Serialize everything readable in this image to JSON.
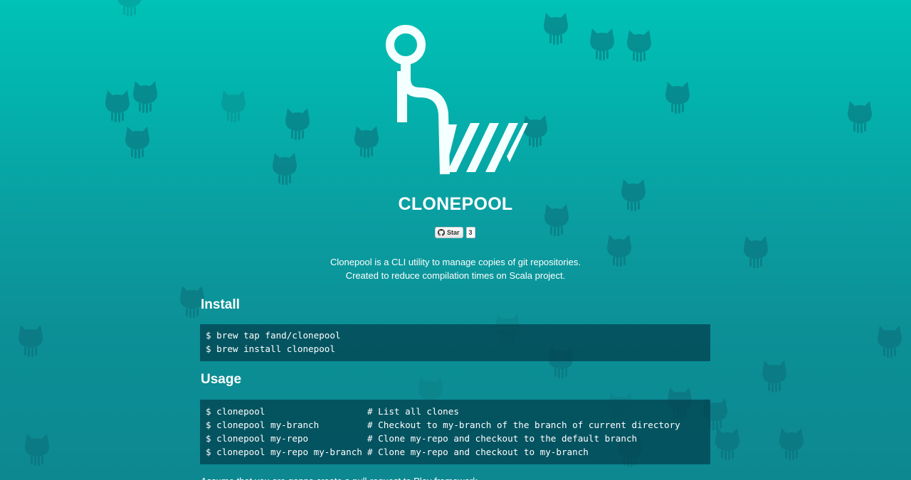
{
  "header": {
    "title": "CLONEPOOL"
  },
  "github_star": {
    "label": "Star",
    "count": "3",
    "icon": "github-octocat-icon"
  },
  "tagline": {
    "line1": "Clonepool is a CLI utility to manage copies of git repositories.",
    "line2": "Created to reduce compilation times on Scala project."
  },
  "install": {
    "heading": "Install",
    "lines": [
      "$ brew tap fand/clonepool",
      "$ brew install clonepool"
    ]
  },
  "usage": {
    "heading": "Usage",
    "lines": [
      {
        "cmd": "$ clonepool",
        "comment": "# List all clones"
      },
      {
        "cmd": "$ clonepool my-branch",
        "comment": "# Checkout to my-branch of the branch of current directory"
      },
      {
        "cmd": "$ clonepool my-repo",
        "comment": "# Clone my-repo and checkout to the default branch"
      },
      {
        "cmd": "$ clonepool my-repo my-branch",
        "comment": "# Clone my-repo and checkout to my-branch"
      }
    ]
  },
  "footer_text": "Assume that you are gonna create a pull-request to Play framework.",
  "colors": {
    "background_top": "#00c2b6",
    "background_bottom": "#0d8891",
    "code_background": "#013e4c",
    "text": "#ffffff"
  }
}
